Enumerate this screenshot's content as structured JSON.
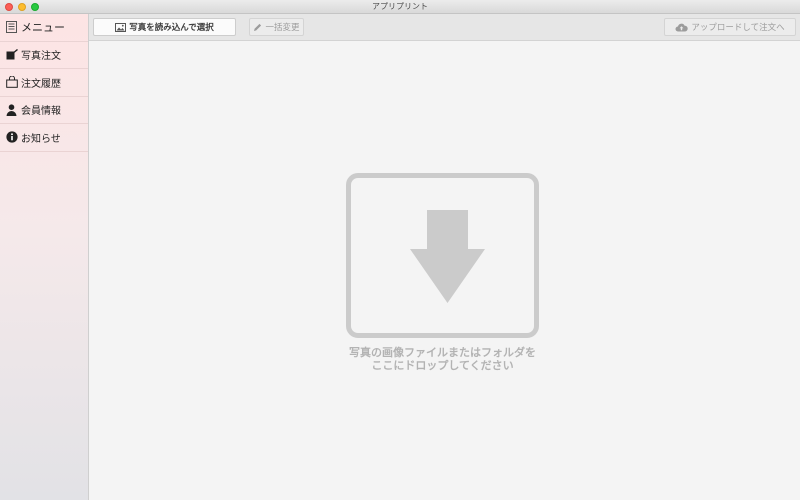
{
  "window": {
    "title": "アプリプリント"
  },
  "sidebar": {
    "items": [
      {
        "label": "メニュー",
        "icon": "list-icon"
      },
      {
        "label": "写真注文",
        "icon": "photo-order-icon"
      },
      {
        "label": "注文履歴",
        "icon": "bag-icon"
      },
      {
        "label": "会員情報",
        "icon": "person-icon"
      },
      {
        "label": "お知らせ",
        "icon": "info-icon"
      }
    ]
  },
  "toolbar": {
    "select_photos_label": "写真を読み込んで選択",
    "bulk_edit_label": "一括変更",
    "upload_label": "アップロードして注文へ"
  },
  "dropzone": {
    "line1": "写真の画像ファイルまたはフォルダを",
    "line2": "ここにドロップしてください"
  },
  "colors": {
    "traffic_close": "#fc5f57",
    "traffic_minimize": "#fdbd2e",
    "traffic_maximize": "#28c941",
    "disabled_text": "#9c9c9c",
    "dropzone_gray": "#cbcbcb"
  }
}
